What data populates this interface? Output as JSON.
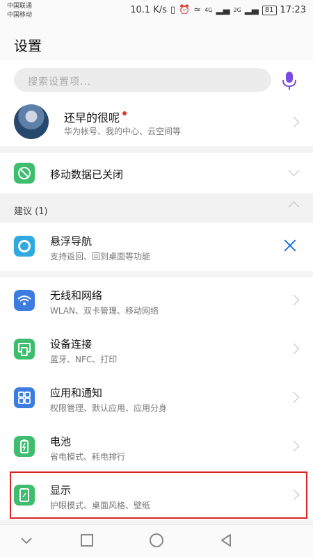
{
  "status_bar": {
    "carrier1": "中国联通",
    "carrier2": "中国移动",
    "speed": "10.1 K/s",
    "net1": "4G",
    "net2": "2G",
    "battery": "81",
    "time": "17:23"
  },
  "header": {
    "title": "设置"
  },
  "search": {
    "placeholder": "搜索设置项..."
  },
  "account": {
    "name": "还早的很呢",
    "subtitle": "华为帐号、我的中心、云空间等"
  },
  "mobile_data": {
    "label": "移动数据已关闭"
  },
  "suggestions": {
    "label": "建议 (1)"
  },
  "floating_nav": {
    "title": "悬浮导航",
    "subtitle": "支持返回、回到桌面等功能"
  },
  "menu": [
    {
      "title": "无线和网络",
      "subtitle": "WLAN、双卡管理、移动网络",
      "icon": "wifi-icon",
      "color": "#3c7be0"
    },
    {
      "title": "设备连接",
      "subtitle": "蓝牙、NFC、打印",
      "icon": "device-connect-icon",
      "color": "#3ebd6e"
    },
    {
      "title": "应用和通知",
      "subtitle": "权限管理、默认应用、应用分身",
      "icon": "apps-icon",
      "color": "#3c7be0"
    },
    {
      "title": "电池",
      "subtitle": "省电模式、耗电排行",
      "icon": "battery-icon",
      "color": "#3ebd6e"
    },
    {
      "title": "显示",
      "subtitle": "护眼模式、桌面风格、壁纸",
      "icon": "display-icon",
      "color": "#3ebd6e"
    }
  ],
  "colors": {
    "accent_blue": "#1a73e8",
    "green": "#3ebd6e",
    "highlight_red": "#dd2222",
    "mic_purple": "#7a4be0"
  }
}
